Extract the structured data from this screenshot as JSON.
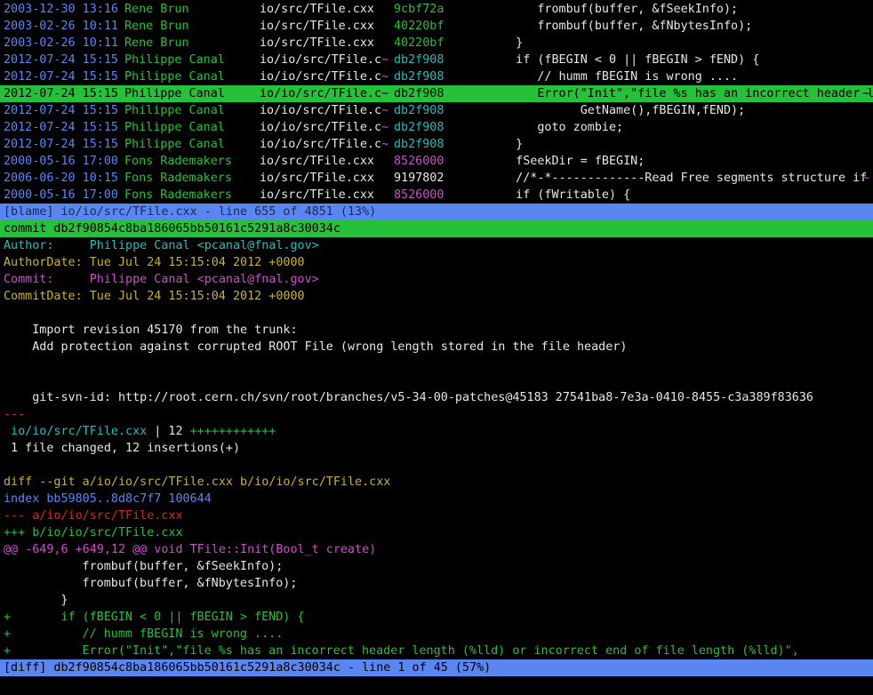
{
  "blame_rows": [
    {
      "date": "2003-12-30 13:16",
      "author": "Rene Brun",
      "file": "io/src/TFile.cxx",
      "tilde": "",
      "hash": "9cbf72a",
      "hash_color": "#27c03a",
      "code": "      frombuf(buffer, &fSeekInfo);",
      "edge": ""
    },
    {
      "date": "2003-02-26 10:11",
      "author": "Rene Brun",
      "file": "io/src/TFile.cxx",
      "tilde": "",
      "hash": "40220bf",
      "hash_color": "#27c03a",
      "code": "      frombuf(buffer, &fNbytesInfo);",
      "edge": ""
    },
    {
      "date": "2003-02-26 10:11",
      "author": "Rene Brun",
      "file": "io/src/TFile.cxx",
      "tilde": "",
      "hash": "40220bf",
      "hash_color": "#27c03a",
      "code": "   }",
      "edge": ""
    },
    {
      "date": "2012-07-24 15:15",
      "author": "Philippe Canal",
      "file": "io/io/src/TFile.c",
      "tilde": "~",
      "hash": "db2f908",
      "hash_color": "#1fbfbf",
      "code": "   if (fBEGIN < 0 || fBEGIN > fEND) {",
      "edge": ""
    },
    {
      "date": "2012-07-24 15:15",
      "author": "Philippe Canal",
      "file": "io/io/src/TFile.c",
      "tilde": "~",
      "hash": "db2f908",
      "hash_color": "#1fbfbf",
      "code": "      // humm fBEGIN is wrong ....",
      "edge": ""
    },
    {
      "date": "2012-07-24 15:15",
      "author": "Philippe Canal",
      "file": "io/io/src/TFile.c",
      "tilde": "~",
      "hash": "db2f908",
      "hash_color": "#1fbfbf",
      "code": "      Error(\"Init\",\"file %s has an incorrect header len",
      "edge": "~",
      "selected": true
    },
    {
      "date": "2012-07-24 15:15",
      "author": "Philippe Canal",
      "file": "io/io/src/TFile.c",
      "tilde": "~",
      "hash": "db2f908",
      "hash_color": "#1fbfbf",
      "code": "            GetName(),fBEGIN,fEND);",
      "edge": ""
    },
    {
      "date": "2012-07-24 15:15",
      "author": "Philippe Canal",
      "file": "io/io/src/TFile.c",
      "tilde": "~",
      "hash": "db2f908",
      "hash_color": "#1fbfbf",
      "code": "      goto zombie;",
      "edge": ""
    },
    {
      "date": "2012-07-24 15:15",
      "author": "Philippe Canal",
      "file": "io/io/src/TFile.c",
      "tilde": "~",
      "hash": "db2f908",
      "hash_color": "#1fbfbf",
      "code": "   }",
      "edge": ""
    },
    {
      "date": "2000-05-16 17:00",
      "author": "Fons Rademakers",
      "file": "io/src/TFile.cxx",
      "tilde": "",
      "hash": "8526000",
      "hash_color": "#d14bd1",
      "code": "   fSeekDir = fBEGIN;",
      "edge": ""
    },
    {
      "date": "2006-06-20 10:15",
      "author": "Fons Rademakers",
      "file": "io/src/TFile.cxx",
      "tilde": "",
      "hash": "9197802",
      "hash_color": "#e6e6e6",
      "code": "   //*-*-------------Read Free segments structure if fi",
      "edge": "~"
    },
    {
      "date": "2000-05-16 17:00",
      "author": "Fons Rademakers",
      "file": "io/src/TFile.cxx",
      "tilde": "",
      "hash": "8526000",
      "hash_color": "#d14bd1",
      "code": "   if (fWritable) {",
      "edge": ""
    }
  ],
  "blame_status": "[blame] io/io/src/TFile.cxx - line 655 of 4851 (13%)",
  "commit_line": "commit db2f90854c8ba186065bb50161c5291a8c30034c",
  "author_label": "Author:     ",
  "author_value": "Philippe Canal <pcanal@fnal.gov>",
  "authordate_label": "AuthorDate: ",
  "authordate_value": "Tue Jul 24 15:15:04 2012 +0000",
  "commit_label": "Commit:     ",
  "commit_value": "Philippe Canal <pcanal@fnal.gov>",
  "commitdate_label": "CommitDate: ",
  "commitdate_value": "Tue Jul 24 15:15:04 2012 +0000",
  "message_line1": "    Import revision 45170 from the trunk:",
  "message_line2": "    Add protection against corrupted ROOT File (wrong length stored in the file header)",
  "gitsvn_line": "    git-svn-id: http://root.cern.ch/svn/root/branches/v5-34-00-patches@45183 27541ba8-7e3a-0410-8455-c3a389f83636",
  "separator": "---",
  "stat_file": " io/io/src/TFile.cxx",
  "stat_count": " | 12 ",
  "stat_plus": "++++++++++++",
  "stat_summary": " 1 file changed, 12 insertions(+)",
  "diff_header": "diff --git a/io/io/src/TFile.cxx b/io/io/src/TFile.cxx",
  "diff_index": "index bb59805..8d8c7f7 100644",
  "diff_minus_file": "--- a/io/io/src/TFile.cxx",
  "diff_plus_file": "+++ b/io/io/src/TFile.cxx",
  "hunk_header": "@@ -649,6 +649,12 @@ void TFile::Init(Bool_t create)",
  "diff_lines": [
    {
      "prefix": " ",
      "text": "         frombuf(buffer, &fSeekInfo);",
      "color": "#e6e6e6"
    },
    {
      "prefix": " ",
      "text": "         frombuf(buffer, &fNbytesInfo);",
      "color": "#e6e6e6"
    },
    {
      "prefix": " ",
      "text": "      }",
      "color": "#e6e6e6"
    },
    {
      "prefix": "+",
      "text": "      if (fBEGIN < 0 || fBEGIN > fEND) {",
      "color": "#27c03a"
    },
    {
      "prefix": "+",
      "text": "         // humm fBEGIN is wrong ....",
      "color": "#27c03a"
    },
    {
      "prefix": "+",
      "text": "         Error(\"Init\",\"file %s has an incorrect header length (%lld) or incorrect end of file length (%lld)\",",
      "color": "#27c03a"
    }
  ],
  "diff_status": "[diff] db2f90854c8ba186065bb50161c5291a8c30034c - line 1 of 45 (57%)"
}
